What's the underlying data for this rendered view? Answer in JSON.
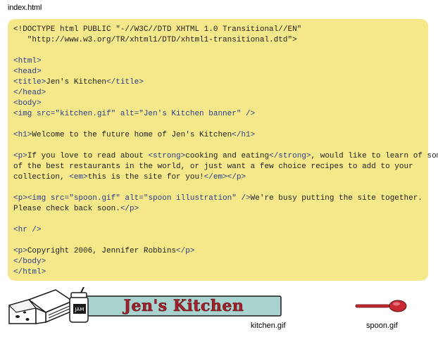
{
  "filename": "index.html",
  "code_lines": [
    "<!DOCTYPE html PUBLIC \"-//W3C//DTD XHTML 1.0 Transitional//EN\"",
    "   \"http://www.w3.org/TR/xhtml1/DTD/xhtml1-transitional.dtd\">",
    "",
    "<html>",
    "<head>",
    "<title>Jen's Kitchen</title>",
    "</head>",
    "<body>",
    "<img src=\"kitchen.gif\" alt=\"Jen's Kitchen banner\" />",
    "",
    "<h1>Welcome to the future home of Jen's Kitchen</h1>",
    "",
    "<p>If you love to read about <strong>cooking and eating</strong>, would like to learn of some",
    "of the best restaurants in the world, or just want a few choice recipes to add to your",
    "collection, <em>this is the site for you!</em></p>",
    "",
    "<p><img src=\"spoon.gif\" alt=\"spoon illustration\" />We're busy putting the site together.",
    "Please check back soon.</p>",
    "",
    "<hr />",
    "",
    "<p>Copyright 2006, Jennifer Robbins</p>",
    "</body>",
    "</html>"
  ],
  "banner_text": "Jen's Kitchen",
  "kitchen_caption": "kitchen.gif",
  "spoon_caption": "spoon.gif",
  "colors": {
    "code_bg": "#f5e88a",
    "tag": "#2b3d8f",
    "banner_bg": "#a9d3cf",
    "banner_text": "#a4202b",
    "spoon": "#c8282f"
  }
}
